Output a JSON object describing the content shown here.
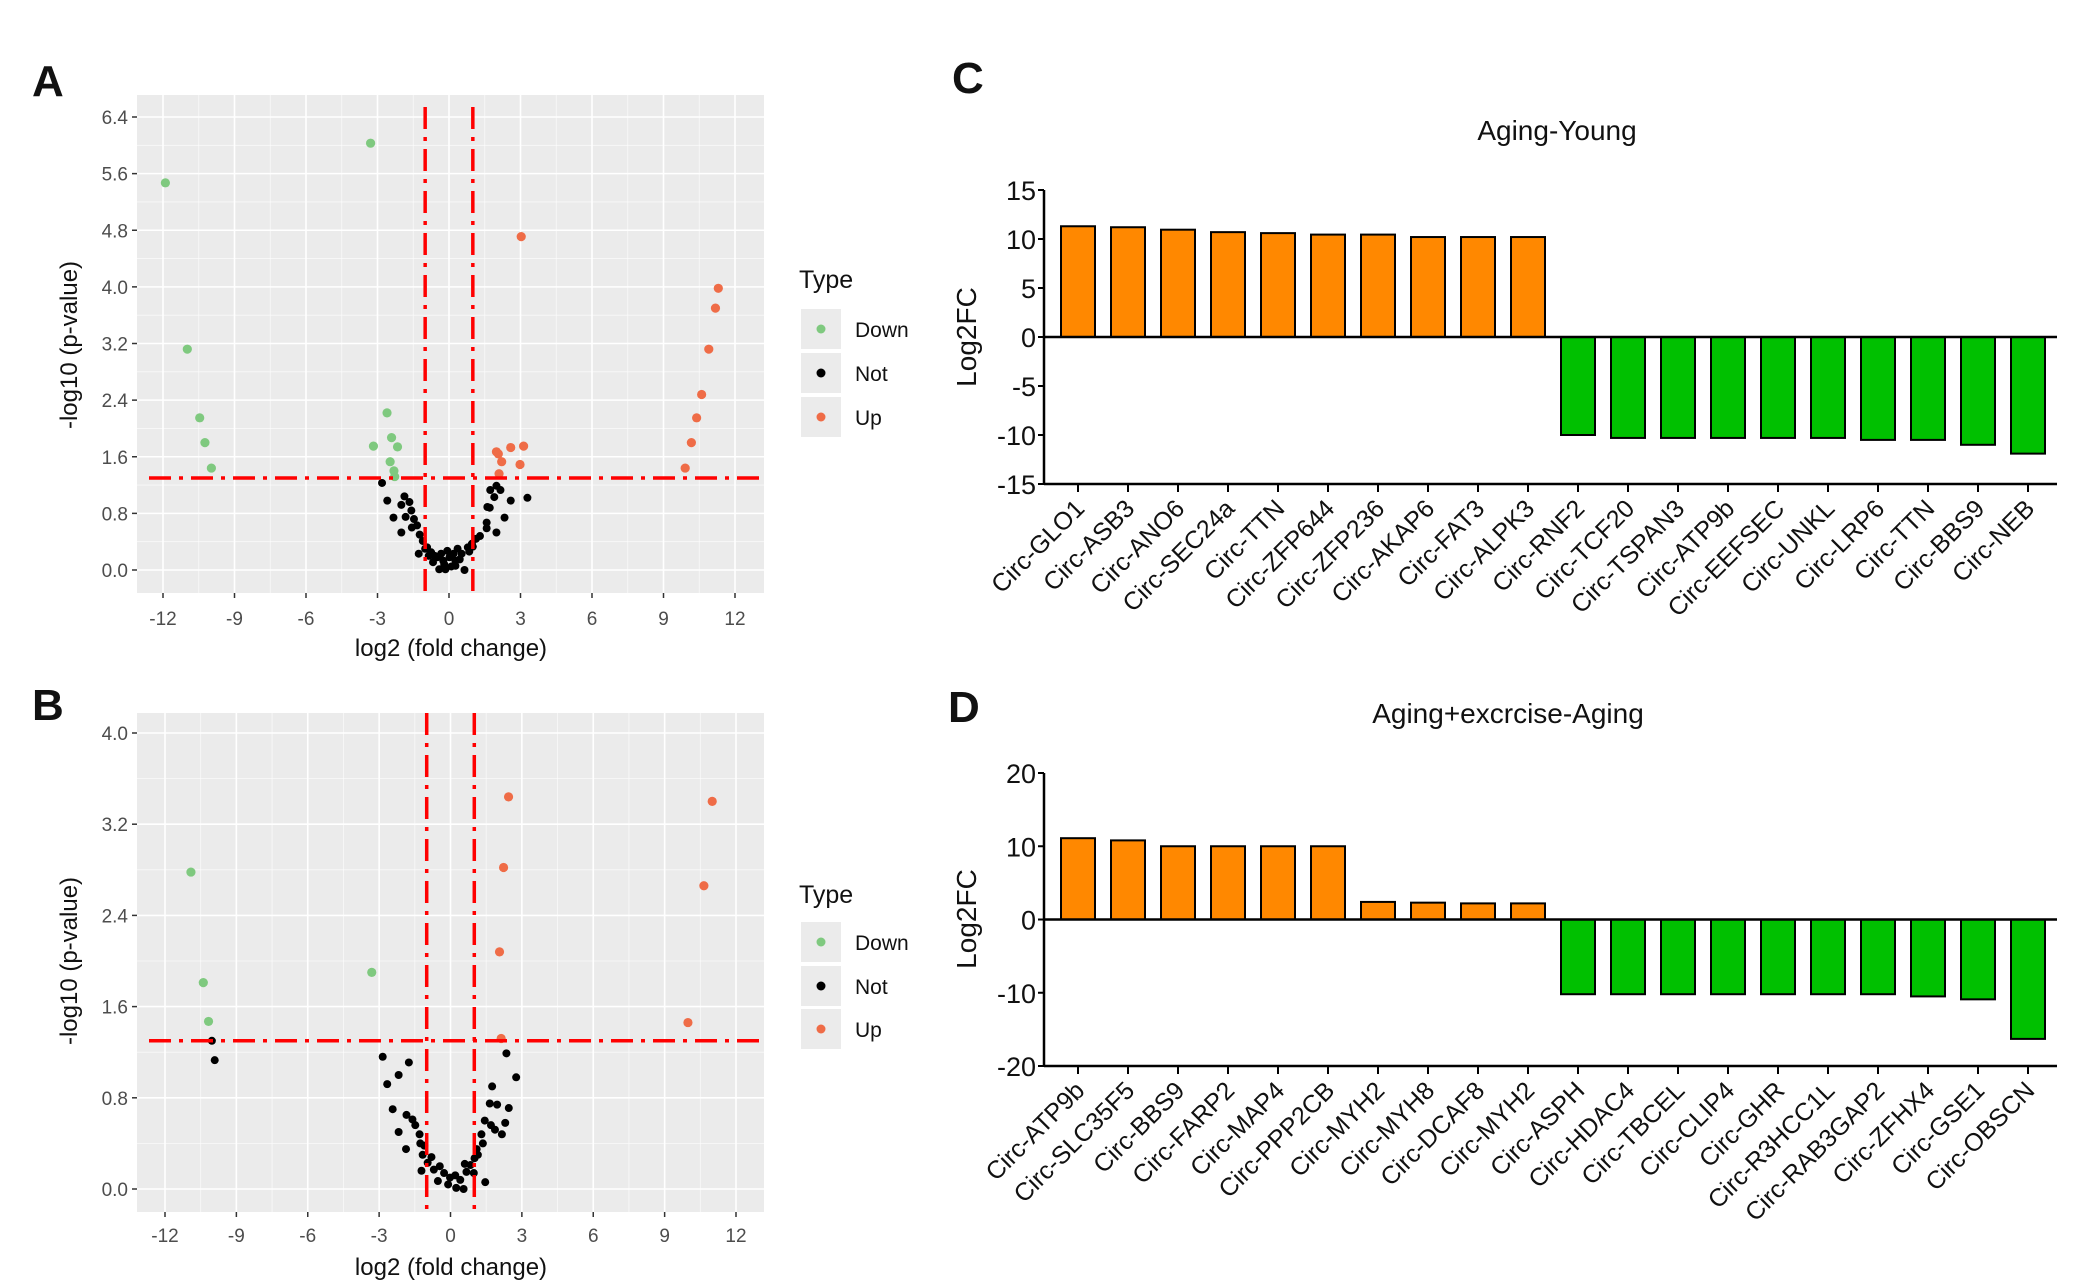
{
  "colors": {
    "down_point": "#7fc97f",
    "not_point": "#000000",
    "up_point": "#ef6c47",
    "threshold_line": "#ff0000",
    "panel_bg": "#ebebeb",
    "grid": "#ffffff",
    "bar_up": "#ff8800",
    "bar_down": "#00c000",
    "bar_outline": "#000000"
  },
  "chart_data": [
    {
      "id": "A",
      "panel_letter": "A",
      "type": "scatter",
      "title": "",
      "xlabel": "log2 (fold change)",
      "ylabel": "-log10 (p-value)",
      "xlim": [
        -13.1,
        13.1
      ],
      "ylim": [
        -0.35,
        6.65
      ],
      "xticks": [
        -12,
        -9,
        -6,
        -3,
        0,
        3,
        6,
        9,
        12
      ],
      "xtick_labels": [
        "-12",
        "-9",
        "-6",
        "-3",
        "0",
        "3",
        "6",
        "9",
        "12"
      ],
      "yticks": [
        0.0,
        0.8,
        1.6,
        2.4,
        3.2,
        4.0,
        4.8,
        5.6,
        6.4
      ],
      "ytick_labels": [
        "0.0",
        "0.8",
        "1.6",
        "2.4",
        "3.2",
        "4.0",
        "4.8",
        "5.6",
        "6.4"
      ],
      "grid": true,
      "thresholds": {
        "x": [
          -1,
          1
        ],
        "y": 1.3
      },
      "legend": {
        "title": "Type",
        "position": "right",
        "entries": [
          "Down",
          "Not",
          "Up"
        ]
      },
      "series": [
        {
          "name": "Down",
          "points": [
            [
              -11.9,
              5.47
            ],
            [
              -3.29,
              6.03
            ],
            [
              -10.98,
              3.12
            ],
            [
              -10.46,
              2.15
            ],
            [
              -10.24,
              1.8
            ],
            [
              -9.97,
              1.44
            ],
            [
              -2.6,
              2.22
            ],
            [
              -2.41,
              1.87
            ],
            [
              -3.17,
              1.75
            ],
            [
              -2.16,
              1.74
            ],
            [
              -2.47,
              1.53
            ],
            [
              -2.31,
              1.4
            ],
            [
              -2.28,
              1.32
            ]
          ]
        },
        {
          "name": "Not",
          "points": [
            [
              -2.81,
              1.23
            ],
            [
              -2.59,
              0.98
            ],
            [
              -1.87,
              1.04
            ],
            [
              -1.66,
              0.96
            ],
            [
              -2.0,
              0.92
            ],
            [
              -2.33,
              0.74
            ],
            [
              -1.82,
              0.75
            ],
            [
              -1.58,
              0.84
            ],
            [
              -1.47,
              0.72
            ],
            [
              -1.56,
              0.6
            ],
            [
              -1.34,
              0.63
            ],
            [
              -2.0,
              0.53
            ],
            [
              -1.23,
              0.5
            ],
            [
              -1.1,
              0.41
            ],
            [
              -0.92,
              0.32
            ],
            [
              -1.27,
              0.23
            ],
            [
              -0.75,
              0.25
            ],
            [
              -0.5,
              0.18
            ],
            [
              -0.24,
              0.13
            ],
            [
              -0.41,
              0.01
            ],
            [
              0.02,
              0.18
            ],
            [
              0.27,
              0.13
            ],
            [
              0.53,
              0.23
            ],
            [
              0.79,
              0.32
            ],
            [
              0.96,
              0.37
            ],
            [
              1.13,
              0.44
            ],
            [
              1.3,
              0.48
            ],
            [
              0.65,
              0.0
            ],
            [
              0.27,
              0.06
            ],
            [
              -0.15,
              0.01
            ],
            [
              1.73,
              1.13
            ],
            [
              1.99,
              1.19
            ],
            [
              1.9,
              1.03
            ],
            [
              2.16,
              1.13
            ],
            [
              2.59,
              0.98
            ],
            [
              3.29,
              1.02
            ],
            [
              1.61,
              0.89
            ],
            [
              1.71,
              0.88
            ],
            [
              2.33,
              0.74
            ],
            [
              1.58,
              0.67
            ],
            [
              1.58,
              0.59
            ],
            [
              1.99,
              0.53
            ],
            [
              -0.07,
              0.27
            ],
            [
              -0.33,
              0.23
            ],
            [
              0.19,
              0.23
            ],
            [
              0.36,
              0.3
            ],
            [
              -0.67,
              0.11
            ],
            [
              -0.6,
              0.2
            ],
            [
              0.45,
              0.15
            ],
            [
              0.1,
              0.05
            ],
            [
              -0.2,
              0.08
            ],
            [
              -1.0,
              0.3
            ],
            [
              1.0,
              0.33
            ],
            [
              -0.85,
              0.2
            ],
            [
              0.85,
              0.26
            ]
          ]
        },
        {
          "name": "Up",
          "points": [
            [
              3.03,
              4.71
            ],
            [
              11.3,
              3.98
            ],
            [
              11.18,
              3.7
            ],
            [
              10.9,
              3.12
            ],
            [
              10.6,
              2.48
            ],
            [
              10.39,
              2.15
            ],
            [
              10.17,
              1.8
            ],
            [
              9.91,
              1.44
            ],
            [
              1.99,
              1.67
            ],
            [
              2.07,
              1.64
            ],
            [
              2.59,
              1.73
            ],
            [
              3.13,
              1.75
            ],
            [
              2.21,
              1.53
            ],
            [
              2.98,
              1.49
            ],
            [
              2.1,
              1.36
            ]
          ]
        }
      ]
    },
    {
      "id": "B",
      "panel_letter": "B",
      "type": "scatter",
      "title": "",
      "xlabel": "log2 (fold change)",
      "ylabel": "-log10 (p-value)",
      "xlim": [
        -13.1,
        13.1
      ],
      "ylim": [
        -0.22,
        4.18
      ],
      "xticks": [
        -12,
        -9,
        -6,
        -3,
        0,
        3,
        6,
        9,
        12
      ],
      "xtick_labels": [
        "-12",
        "-9",
        "-6",
        "-3",
        "0",
        "3",
        "6",
        "9",
        "12"
      ],
      "yticks": [
        0.0,
        0.8,
        1.6,
        2.4,
        3.2,
        4.0
      ],
      "ytick_labels": [
        "0.0",
        "0.8",
        "1.6",
        "2.4",
        "3.2",
        "4.0"
      ],
      "grid": true,
      "thresholds": {
        "x": [
          -1,
          1
        ],
        "y": 1.3
      },
      "legend": {
        "title": "Type",
        "position": "right",
        "entries": [
          "Down",
          "Not",
          "Up"
        ]
      },
      "series": [
        {
          "name": "Down",
          "points": [
            [
              -10.91,
              2.78
            ],
            [
              -10.39,
              1.81
            ],
            [
              -10.17,
              1.47
            ],
            [
              -3.31,
              1.9
            ]
          ]
        },
        {
          "name": "Not",
          "points": [
            [
              -10.03,
              1.3
            ],
            [
              -9.91,
              1.13
            ],
            [
              -2.85,
              1.16
            ],
            [
              -1.75,
              1.11
            ],
            [
              -2.66,
              0.92
            ],
            [
              -2.18,
              1.0
            ],
            [
              -2.43,
              0.7
            ],
            [
              -1.85,
              0.65
            ],
            [
              -1.6,
              0.61
            ],
            [
              -1.48,
              0.56
            ],
            [
              -2.18,
              0.5
            ],
            [
              -1.87,
              0.35
            ],
            [
              -1.3,
              0.48
            ],
            [
              -1.27,
              0.4
            ],
            [
              -1.17,
              0.3
            ],
            [
              -1.22,
              0.16
            ],
            [
              -0.96,
              0.23
            ],
            [
              -0.7,
              0.17
            ],
            [
              -0.53,
              0.07
            ],
            [
              -0.27,
              0.14
            ],
            [
              -0.02,
              0.1
            ],
            [
              0.24,
              0.01
            ],
            [
              0.55,
              0.0
            ],
            [
              0.41,
              0.08
            ],
            [
              0.67,
              0.15
            ],
            [
              0.84,
              0.21
            ],
            [
              1.01,
              0.27
            ],
            [
              1.1,
              0.35
            ],
            [
              1.36,
              0.4
            ],
            [
              1.3,
              0.48
            ],
            [
              1.44,
              0.6
            ],
            [
              1.7,
              0.56
            ],
            [
              1.87,
              0.52
            ],
            [
              2.16,
              0.48
            ],
            [
              2.3,
              0.58
            ],
            [
              2.45,
              0.71
            ],
            [
              1.65,
              0.75
            ],
            [
              1.96,
              0.74
            ],
            [
              1.75,
              0.9
            ],
            [
              2.76,
              0.98
            ],
            [
              2.35,
              1.19
            ],
            [
              1.46,
              0.06
            ],
            [
              0.98,
              0.14
            ],
            [
              -0.45,
              0.2
            ],
            [
              -0.8,
              0.28
            ],
            [
              0.2,
              0.12
            ],
            [
              -0.1,
              0.04
            ],
            [
              0.6,
              0.22
            ],
            [
              -1.1,
              0.38
            ],
            [
              1.15,
              0.3
            ]
          ]
        },
        {
          "name": "Up",
          "points": [
            [
              2.44,
              3.44
            ],
            [
              11.0,
              3.4
            ],
            [
              2.23,
              2.82
            ],
            [
              10.65,
              2.66
            ],
            [
              2.06,
              2.08
            ],
            [
              9.98,
              1.46
            ],
            [
              2.13,
              1.32
            ]
          ]
        }
      ]
    },
    {
      "id": "C",
      "panel_letter": "C",
      "type": "bar",
      "title": "Aging-Young",
      "xlabel": "",
      "ylabel": "Log2FC",
      "ylim": [
        -15,
        15
      ],
      "yticks": [
        15,
        10,
        5,
        0,
        -5,
        -10,
        -15
      ],
      "ytick_labels": [
        "15",
        "10",
        "5",
        "0",
        "-5",
        "-10",
        "-15"
      ],
      "grid": false,
      "categories": [
        "Circ-GLO1",
        "Circ-ASB3",
        "Circ-ANO6",
        "Circ-SEC24a",
        "Circ-TTN",
        "Circ-ZFP644",
        "Circ-ZFP236",
        "Circ-AKAP6",
        "Circ-FAT3",
        "Circ-ALPK3",
        "Circ-RNF2",
        "Circ-TCF20",
        "Circ-TSPAN3",
        "Circ-ATP9b",
        "Circ-EEFSEC",
        "Circ-UNKL",
        "Circ-LRP6",
        "Circ-TTN",
        "Circ-BBS9",
        "Circ-NEB"
      ],
      "values": [
        11.3,
        11.2,
        10.95,
        10.7,
        10.6,
        10.45,
        10.45,
        10.2,
        10.2,
        10.2,
        -10.0,
        -10.3,
        -10.3,
        -10.3,
        -10.3,
        -10.3,
        -10.5,
        -10.5,
        -11.0,
        -11.9
      ]
    },
    {
      "id": "D",
      "panel_letter": "D",
      "type": "bar",
      "title": "Aging+excrcise-Aging",
      "xlabel": "",
      "ylabel": "Log2FC",
      "ylim": [
        -20,
        20
      ],
      "yticks": [
        20,
        10,
        0,
        -10,
        -20
      ],
      "ytick_labels": [
        "20",
        "10",
        "0",
        "-10",
        "-20"
      ],
      "grid": false,
      "categories": [
        "Circ-ATP9b",
        "Circ-SLC35F5",
        "Circ-BBS9",
        "Circ-FARP2",
        "Circ-MAP4",
        "Circ-PPP2CB",
        "Circ-MYH2",
        "Circ-MYH8",
        "Circ-DCAF8",
        "Circ-MYH2",
        "Circ-ASPH",
        "Circ-HDAC4",
        "Circ-TBCEL",
        "Circ-CLIP4",
        "Circ-GHR",
        "Circ-R3HCC1L",
        "Circ-RAB3GAP2",
        "Circ-ZFHX4",
        "Circ-GSE1",
        "Circ-OBSCN"
      ],
      "values": [
        11.1,
        10.8,
        10.0,
        10.0,
        10.0,
        10.0,
        2.4,
        2.3,
        2.2,
        2.2,
        -10.2,
        -10.2,
        -10.2,
        -10.2,
        -10.2,
        -10.2,
        -10.2,
        -10.5,
        -10.9,
        -16.3
      ]
    }
  ]
}
